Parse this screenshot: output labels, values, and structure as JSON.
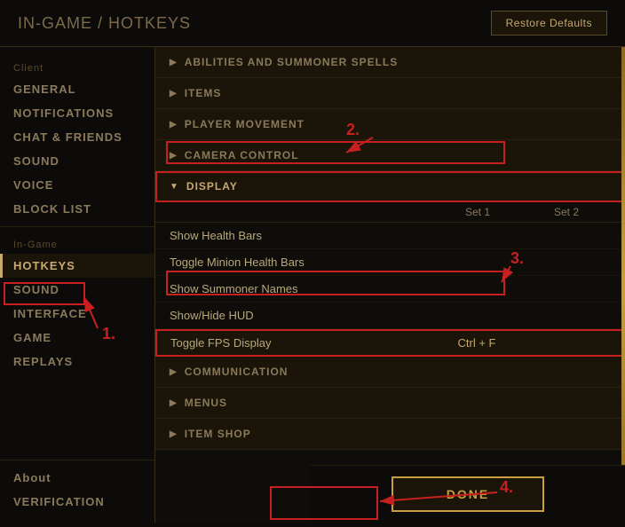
{
  "header": {
    "breadcrumb_prefix": "IN-GAME / ",
    "breadcrumb_current": "HOTKEYS",
    "restore_button": "Restore Defaults"
  },
  "sidebar": {
    "client_label": "Client",
    "client_items": [
      {
        "id": "general",
        "label": "GENERAL",
        "active": false
      },
      {
        "id": "notifications",
        "label": "NOTIFICATIONS",
        "active": false
      },
      {
        "id": "chat-friends",
        "label": "CHAT & FRIENDS",
        "active": false
      },
      {
        "id": "sound-client",
        "label": "SOUND",
        "active": false
      },
      {
        "id": "voice",
        "label": "VOICE",
        "active": false
      },
      {
        "id": "block-list",
        "label": "BLOCK LIST",
        "active": false
      }
    ],
    "ingame_label": "In-Game",
    "ingame_items": [
      {
        "id": "hotkeys",
        "label": "HOTKEYS",
        "active": true
      },
      {
        "id": "sound-ingame",
        "label": "SOUND",
        "active": false
      },
      {
        "id": "interface",
        "label": "INTERFACE",
        "active": false
      },
      {
        "id": "game",
        "label": "GAME",
        "active": false
      },
      {
        "id": "replays",
        "label": "REPLAYS",
        "active": false
      }
    ],
    "about_label": "About",
    "verification_label": "VERIFICATION"
  },
  "content": {
    "sections": [
      {
        "id": "abilities",
        "label": "ABILITIES AND SUMMONER SPELLS",
        "expanded": false
      },
      {
        "id": "items",
        "label": "ITEMS",
        "expanded": false
      },
      {
        "id": "player-movement",
        "label": "PLAYER MOVEMENT",
        "expanded": false
      },
      {
        "id": "camera-control",
        "label": "CAMERA CONTROL",
        "expanded": false
      },
      {
        "id": "display",
        "label": "DISPLAY",
        "expanded": true
      },
      {
        "id": "communication",
        "label": "COMMUNICATION",
        "expanded": false
      },
      {
        "id": "menus",
        "label": "MENUS",
        "expanded": false
      },
      {
        "id": "item-shop",
        "label": "ITEM SHOP",
        "expanded": false
      }
    ],
    "display_table": {
      "col_set1": "Set 1",
      "col_set2": "Set 2",
      "rows": [
        {
          "name": "Show Health Bars",
          "set1": "",
          "set2": ""
        },
        {
          "name": "Toggle Minion Health Bars",
          "set1": "",
          "set2": ""
        },
        {
          "name": "Show Summoner Names",
          "set1": "",
          "set2": ""
        },
        {
          "name": "Show/Hide HUD",
          "set1": "",
          "set2": ""
        },
        {
          "name": "Toggle FPS Display",
          "set1": "Ctrl + F",
          "set2": "",
          "highlighted": true
        }
      ]
    }
  },
  "footer": {
    "done_label": "DONE"
  },
  "annotations": {
    "1": "1.",
    "2": "2.",
    "3": "3.",
    "4": "4."
  }
}
